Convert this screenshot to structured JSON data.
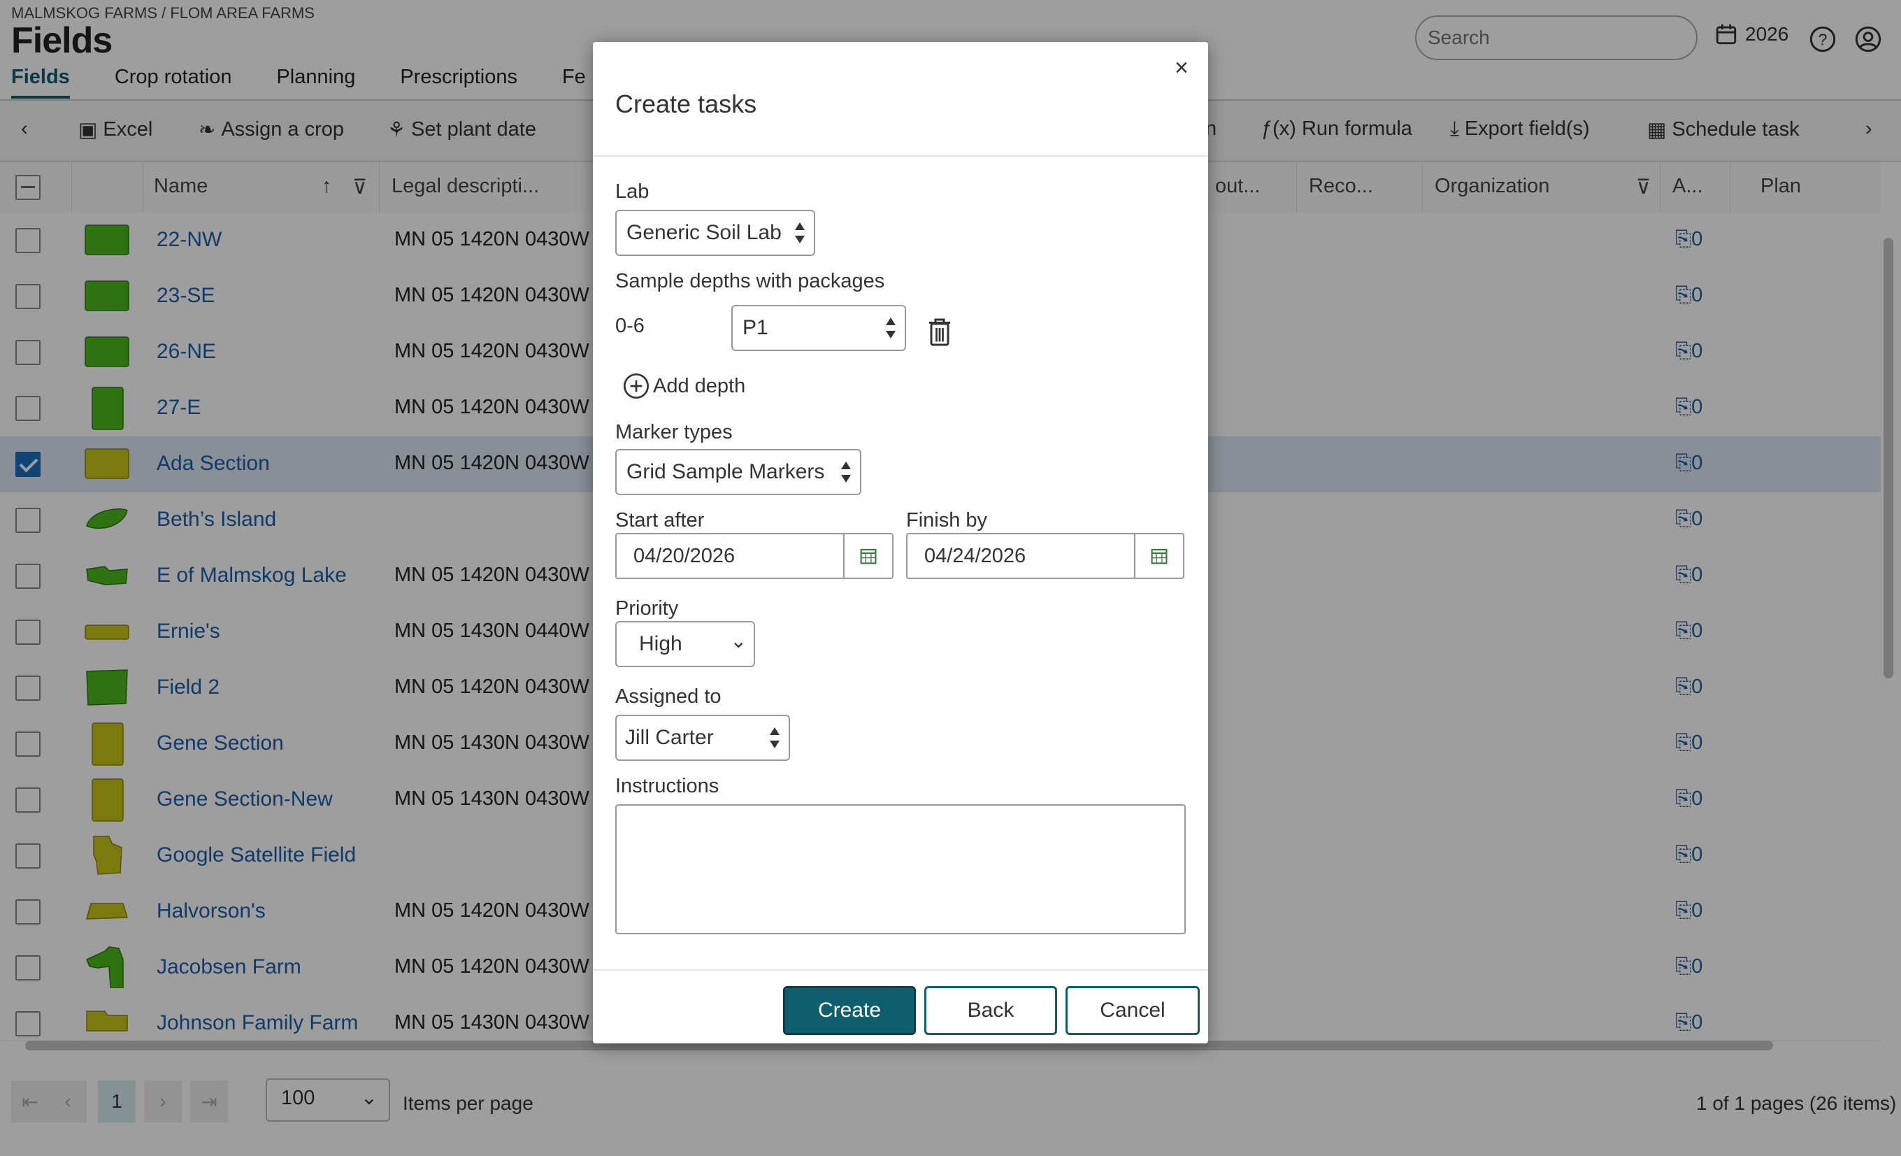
{
  "header": {
    "breadcrumb": "MALMSKOG FARMS / FLOM AREA FARMS",
    "title": "Fields",
    "search_placeholder": "Search",
    "year": "2026"
  },
  "tabs": [
    {
      "label": "Fields",
      "active": true
    },
    {
      "label": "Crop rotation"
    },
    {
      "label": "Planning"
    },
    {
      "label": "Prescriptions"
    },
    {
      "label": "Fe"
    }
  ],
  "toolbar": {
    "excel": "Excel",
    "assign_crop": "Assign a crop",
    "set_plant_date": "Set plant date",
    "partial_hidden": "n",
    "run_formula": "Run formula",
    "export_fields": "Export field(s)",
    "schedule_task": "Schedule task"
  },
  "columns": {
    "name": "Name",
    "legal": "Legal descripti...",
    "output": "out...",
    "reco": "Reco...",
    "organization": "Organization",
    "attach": "A...",
    "plan": "Plan"
  },
  "rows": [
    {
      "name": "22-NW",
      "legal": "MN 05 1420N 0430W",
      "attach": "0",
      "selected": false
    },
    {
      "name": "23-SE",
      "legal": "MN 05 1420N 0430W",
      "attach": "0",
      "selected": false
    },
    {
      "name": "26-NE",
      "legal": "MN 05 1420N 0430W",
      "attach": "0",
      "selected": false
    },
    {
      "name": "27-E",
      "legal": "MN 05 1420N 0430W",
      "attach": "0",
      "selected": false
    },
    {
      "name": "Ada Section",
      "legal": "MN 05 1420N 0430W",
      "attach": "0",
      "selected": true
    },
    {
      "name": "Beth’s Island",
      "legal": "",
      "attach": "0",
      "selected": false
    },
    {
      "name": "E of Malmskog Lake",
      "legal": "MN 05 1420N 0430W",
      "attach": "0",
      "selected": false
    },
    {
      "name": "Ernie's",
      "legal": "MN 05 1430N 0440W",
      "attach": "0",
      "selected": false
    },
    {
      "name": "Field 2",
      "legal": "MN 05 1420N 0430W",
      "attach": "0",
      "selected": false
    },
    {
      "name": "Gene Section",
      "legal": "MN 05 1430N 0430W",
      "attach": "0",
      "selected": false
    },
    {
      "name": "Gene Section-New",
      "legal": "MN 05 1430N 0430W",
      "attach": "0",
      "selected": false
    },
    {
      "name": "Google Satellite Field",
      "legal": "",
      "attach": "0",
      "selected": false
    },
    {
      "name": "Halvorson's",
      "legal": "MN 05 1420N 0430W",
      "attach": "0",
      "selected": false
    },
    {
      "name": "Jacobsen Farm",
      "legal": "MN 05 1420N 0430W",
      "attach": "0",
      "selected": false
    },
    {
      "name": "Johnson Family Farm",
      "legal": "MN 05 1430N 0430W",
      "attach": "0",
      "selected": false
    }
  ],
  "pager": {
    "current_page": "1",
    "per_page": "100",
    "items_label": "Items per page",
    "info": "1 of 1 pages (26 items)"
  },
  "modal": {
    "title": "Create tasks",
    "close": "×",
    "lab_label": "Lab",
    "lab_value": "Generic Soil Lab",
    "depths_label": "Sample depths with packages",
    "depth_value": "0-6",
    "package_value": "P1",
    "add_depth": "Add depth",
    "marker_label": "Marker types",
    "marker_value": "Grid Sample Markers",
    "start_label": "Start after",
    "start_value": "04/20/2026",
    "finish_label": "Finish by",
    "finish_value": "04/24/2026",
    "priority_label": "Priority",
    "priority_value": "High",
    "assigned_label": "Assigned to",
    "assigned_value": "Jill Carter",
    "instructions_label": "Instructions",
    "instructions_value": "",
    "create": "Create",
    "back": "Back",
    "cancel": "Cancel"
  },
  "colors": {
    "accent": "#0f5e6e",
    "link": "#1a5fa8",
    "field_green": "#4cb81c",
    "field_yellow": "#c9c417"
  }
}
